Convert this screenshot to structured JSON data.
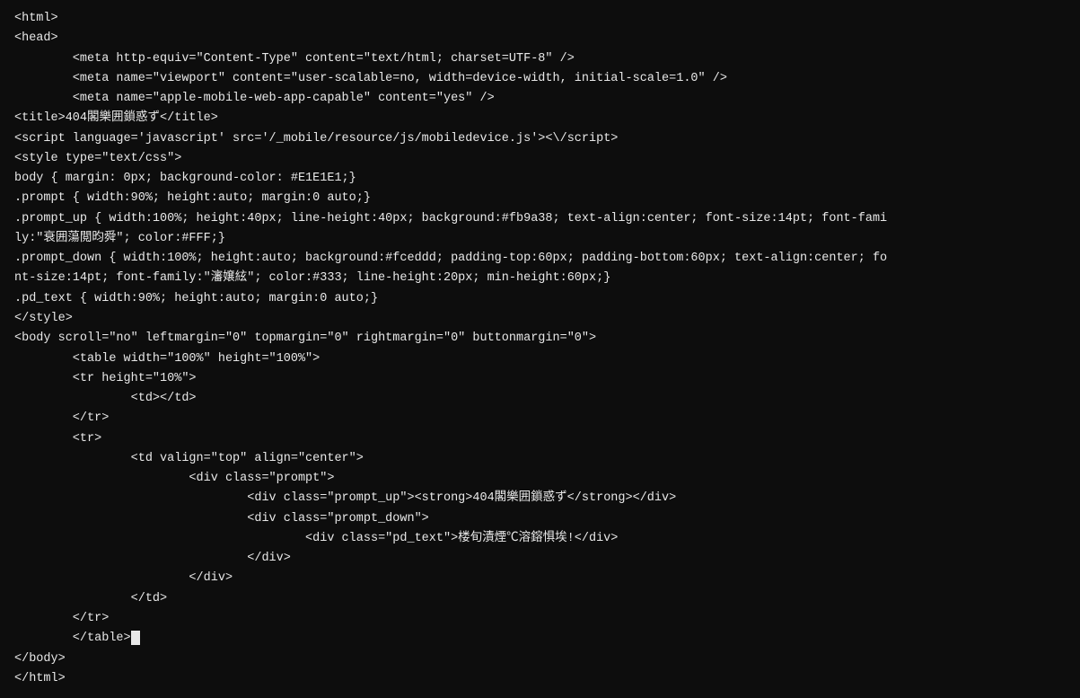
{
  "code": {
    "lines": [
      "<html>",
      "<head>",
      "        <meta http-equiv=\"Content-Type\" content=\"text/html; charset=UTF-8\" />",
      "        <meta name=\"viewport\" content=\"user-scalable=no, width=device-width, initial-scale=1.0\" />",
      "        <meta name=\"apple-mobile-web-app-capable\" content=\"yes\" />",
      "<title>404閣樂囲鎖惑ず</title>",
      "<script language='javascript' src='/_mobile/resource/js/mobiledevice.js'><\\/script>",
      "<style type=\"text/css\">",
      "body { margin: 0px; background-color: #E1E1E1;}",
      ".prompt { width:90%; height:auto; margin:0 auto;}",
      ".prompt_up { width:100%; height:40px; line-height:40px; background:#fb9a38; text-align:center; font-size:14pt; font-fami",
      "ly:\"衰囲蕩閲昀舜\"; color:#FFF;}",
      ".prompt_down { width:100%; height:auto; background:#fceddd; padding-top:60px; padding-bottom:60px; text-align:center; fo",
      "nt-size:14pt; font-family:\"瀋嬢絃\"; color:#333; line-height:20px; min-height:60px;}",
      ".pd_text { width:90%; height:auto; margin:0 auto;}",
      "</style>",
      "<body scroll=\"no\" leftmargin=\"0\" topmargin=\"0\" rightmargin=\"0\" buttonmargin=\"0\">",
      "        <table width=\"100%\" height=\"100%\">",
      "        <tr height=\"10%\">",
      "                <td></td>",
      "",
      "        </tr>",
      "        <tr>",
      "                <td valign=\"top\" align=\"center\">",
      "                        <div class=\"prompt\">",
      "                                <div class=\"prompt_up\"><strong>404閣樂囲鎖惑ず</strong></div>",
      "                                <div class=\"prompt_down\">",
      "                                        <div class=\"pd_text\">楼旬漬煙℃溶鎔惧埃!</div>",
      "                                </div>",
      "                        </div>",
      "",
      "                </td>",
      "        </tr>",
      "        </table>",
      "</body>",
      "</html>"
    ],
    "cursor_line": 33,
    "cursor_visible": true
  }
}
